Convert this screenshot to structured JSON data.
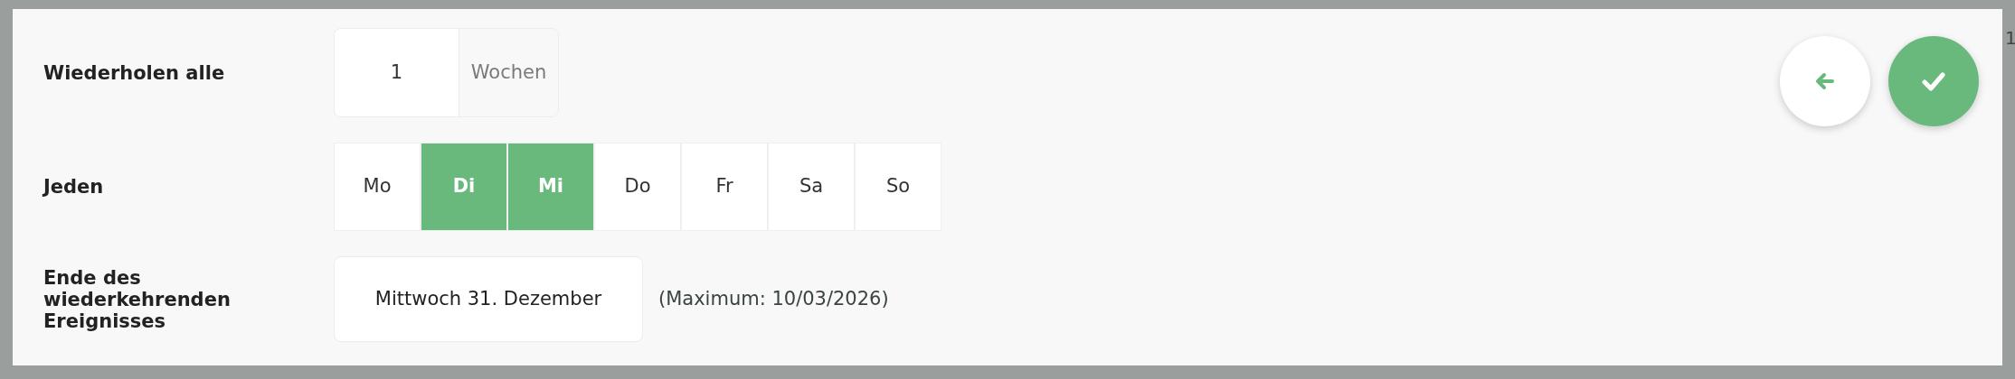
{
  "dialog": {
    "rows": [
      {
        "kind": "interval",
        "label": "Wiederholen alle",
        "value": "1",
        "unit": "Wochen"
      },
      {
        "kind": "weekdays",
        "label": "Jeden",
        "days": [
          {
            "label": "Mo",
            "selected": false
          },
          {
            "label": "Di",
            "selected": true
          },
          {
            "label": "Mi",
            "selected": true
          },
          {
            "label": "Do",
            "selected": false
          },
          {
            "label": "Fr",
            "selected": false
          },
          {
            "label": "Sa",
            "selected": false
          },
          {
            "label": "So",
            "selected": false
          }
        ]
      },
      {
        "kind": "end_date",
        "label": "Ende des wiederkehrenden Ereignisses",
        "value": "Mittwoch 31. Dezember",
        "note": "(Maximum: 10/03/2026)"
      }
    ]
  },
  "backdrop": {
    "edge_text": "1"
  }
}
